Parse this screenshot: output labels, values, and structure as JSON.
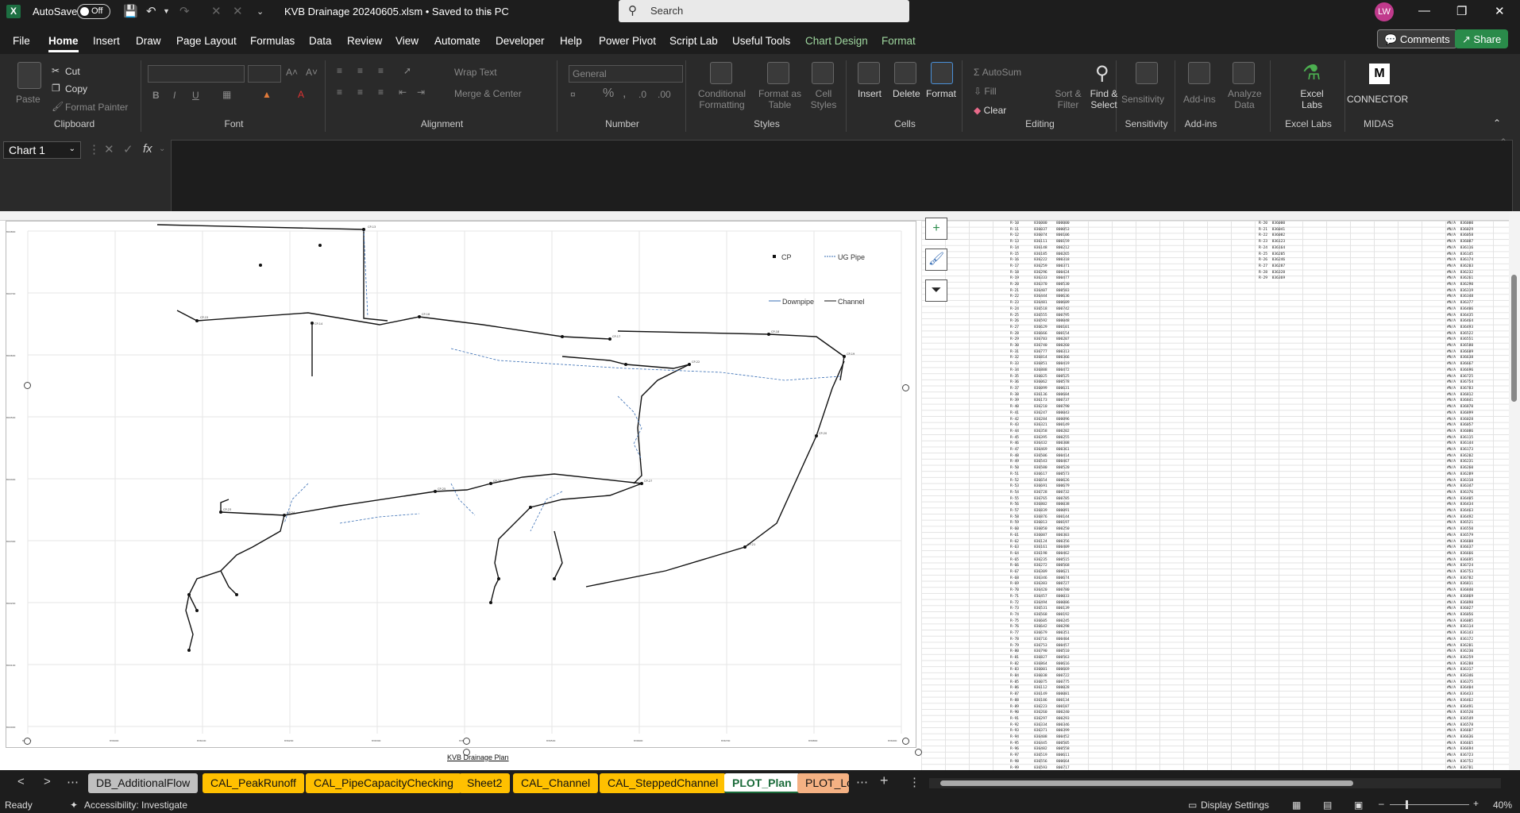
{
  "titlebar": {
    "autosave_label": "AutoSave",
    "autosave_state": "Off",
    "doc_title": "KVB Drainage 20240605.xlsm  •  Saved to this PC",
    "search_placeholder": "Search",
    "user_initials": "LW"
  },
  "menu": {
    "tabs": [
      "File",
      "Home",
      "Insert",
      "Draw",
      "Page Layout",
      "Formulas",
      "Data",
      "Review",
      "View",
      "Automate",
      "Developer",
      "Help",
      "Power Pivot",
      "Script Lab",
      "Useful Tools",
      "Chart Design",
      "Format"
    ],
    "active": "Home",
    "comments_label": "Comments",
    "share_label": "Share"
  },
  "ribbon": {
    "clipboard": {
      "paste": "Paste",
      "cut": "Cut",
      "copy": "Copy",
      "format_painter": "Format Painter",
      "group": "Clipboard"
    },
    "font": {
      "group": "Font",
      "bold": "B",
      "italic": "I",
      "underline": "U"
    },
    "alignment": {
      "group": "Alignment",
      "wrap": "Wrap Text",
      "merge": "Merge & Center"
    },
    "number": {
      "group": "Number",
      "format": "General"
    },
    "styles": {
      "group": "Styles",
      "conditional": "Conditional Formatting",
      "format_table": "Format as Table",
      "cell_styles": "Cell Styles"
    },
    "cells": {
      "group": "Cells",
      "insert": "Insert",
      "delete": "Delete",
      "format": "Format"
    },
    "editing": {
      "group": "Editing",
      "autosum": "AutoSum",
      "fill": "Fill",
      "clear": "Clear",
      "sort": "Sort & Filter",
      "find": "Find & Select"
    },
    "sensitivity": {
      "group": "Sensitivity",
      "label": "Sensitivity"
    },
    "addins": {
      "group": "Add-ins",
      "label": "Add-ins"
    },
    "analyze": {
      "label": "Analyze Data"
    },
    "excellabs": {
      "group": "Excel Labs",
      "label": "Excel Labs"
    },
    "midas": {
      "group": "MIDAS",
      "label": "CONNECTOR"
    }
  },
  "formula_bar": {
    "name_box": "Chart 1",
    "fx": "fx",
    "value": ""
  },
  "chart": {
    "legend_cp": "CP",
    "legend_ugpipe": "UG Pipe",
    "legend_downpipe": "Downpipe",
    "legend_channel": "Channel",
    "caption": "KVB Drainage Plan"
  },
  "sheets": {
    "tabs": [
      {
        "label": "DB_AdditionalFlow",
        "color": "#bfbfbf"
      },
      {
        "label": "CAL_PeakRunoff",
        "color": "#ffc000"
      },
      {
        "label": "CAL_PipeCapacityChecking",
        "color": "#ffc000"
      },
      {
        "label": "Sheet2",
        "color": "#ffc000"
      },
      {
        "label": "CAL_Channel",
        "color": "#ffc000"
      },
      {
        "label": "CAL_SteppedChannel",
        "color": "#ffc000"
      },
      {
        "label": "PLOT_Plan",
        "color": "#ffffff"
      },
      {
        "label": "PLOT_Lo",
        "color": "#f4b183"
      }
    ],
    "active": "PLOT_Plan"
  },
  "status": {
    "ready": "Ready",
    "accessibility": "Accessibility: Investigate",
    "display_settings": "Display Settings",
    "zoom": "40%"
  }
}
